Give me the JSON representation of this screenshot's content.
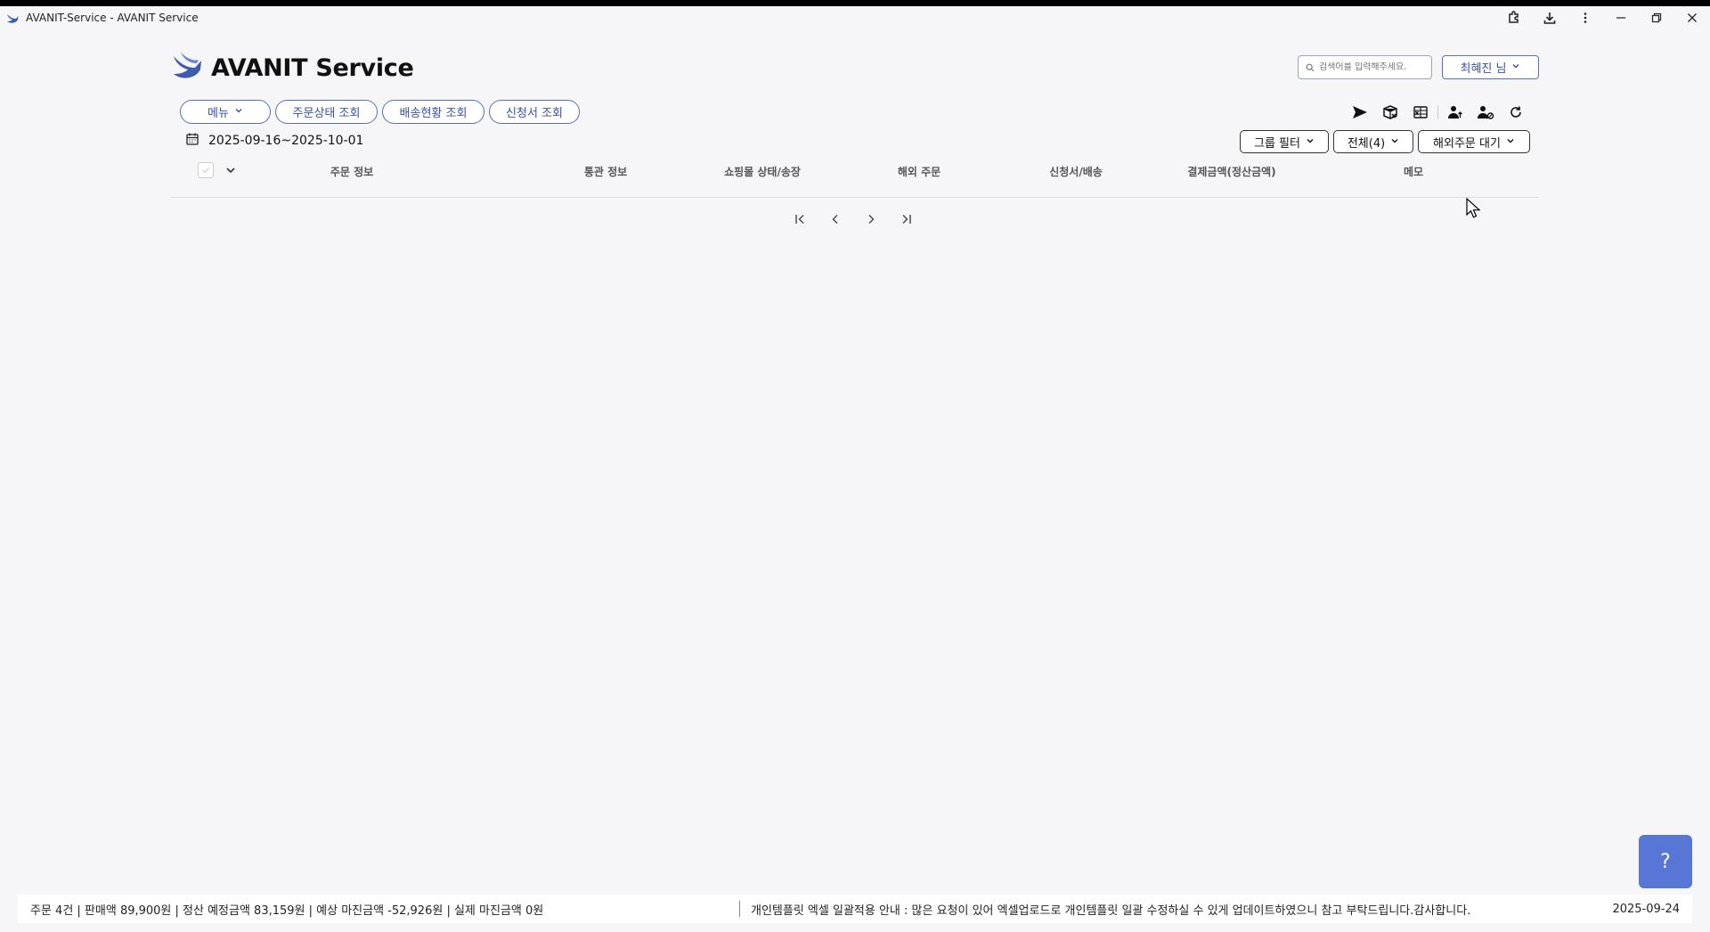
{
  "window": {
    "title": "AVANIT-Service - AVANIT Service"
  },
  "header": {
    "brand": "AVANIT Service",
    "search_placeholder": "검색어를 입력해주세요.",
    "user_label": "최혜진 님"
  },
  "nav": {
    "menu_label": "메뉴",
    "tabs": [
      "주문상태 조회",
      "배송현황 조회",
      "신청서 조회"
    ]
  },
  "date_range": "2025-09-16~2025-10-01",
  "filters": {
    "group_filter": "그룹 필터",
    "all_count": "전체(4)",
    "overseas_status": "해외주문 대기"
  },
  "toolbar_icons": [
    "send-icon",
    "box-cancel-icon",
    "excel-icon",
    "person-upload-icon",
    "person-settings-icon",
    "refresh-icon"
  ],
  "table": {
    "columns": [
      "주문 정보",
      "통관 정보",
      "쇼핑몰 상태/송장",
      "해외 주문",
      "신청서/배송",
      "결제금액(정산금액)",
      "메모"
    ]
  },
  "footer": {
    "stats": "주문 4건 | 판매액 89,900원 | 정산 예정금액 83,159원 | 예상 마진금액 -52,926원 | 실제 마진금액 0원",
    "notice": "개인템플릿 엑셀 일괄적용 안내 : 많은 요청이 있어 엑셀업로드로 개인템플릿 일괄 수정하실 수 있게 업데이트하였으니 참고 부탁드립니다.감사합니다.",
    "date": "2025-09-24"
  },
  "help_button": "?",
  "colors": {
    "accent": "#3a4fa0",
    "help_bg": "#5876d6",
    "page_bg": "#f6f6f8"
  }
}
